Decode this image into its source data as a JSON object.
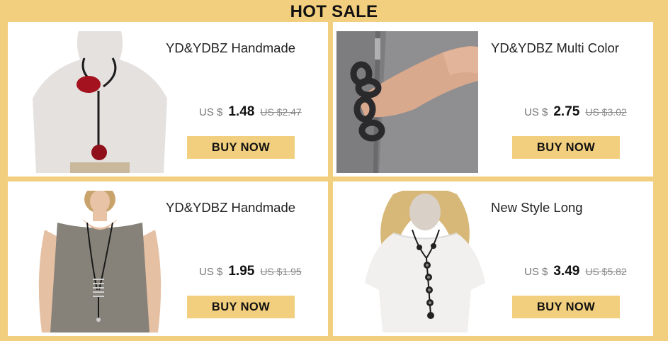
{
  "banner": {
    "title": "HOT SALE"
  },
  "colors": {
    "background": "#f2cf7e",
    "card": "#ffffff",
    "button": "#f2cf7e"
  },
  "products": [
    {
      "title": "YD&YDBZ Handmade",
      "currency": "US $",
      "price": "1.48",
      "old_price": "US $2.47",
      "button": "BUY NOW",
      "image_icon": "red-pendant-necklace-on-mannequin"
    },
    {
      "title": "YD&YDBZ Multi Color",
      "currency": "US $",
      "price": "2.75",
      "old_price": "US $3.02",
      "button": "BUY NOW",
      "image_icon": "chain-link-bracelet-on-wrist"
    },
    {
      "title": "YD&YDBZ Handmade",
      "currency": "US $",
      "price": "1.95",
      "old_price": "US $1.95",
      "button": "BUY NOW",
      "image_icon": "long-necklace-on-model"
    },
    {
      "title": "New Style Long",
      "currency": "US $",
      "price": "3.49",
      "old_price": "US $5.82",
      "button": "BUY NOW",
      "image_icon": "bubble-necklace-on-mannequin"
    }
  ]
}
